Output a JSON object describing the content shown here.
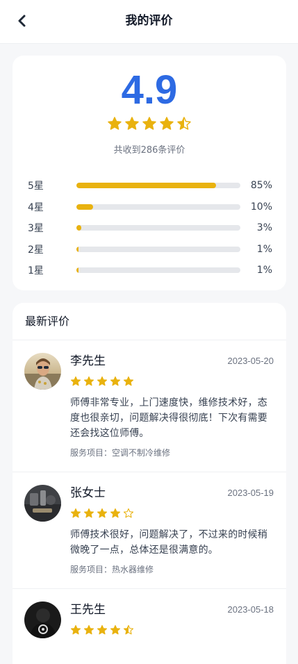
{
  "header": {
    "title": "我的评价",
    "back_icon": "chevron-left-icon"
  },
  "summary": {
    "score": "4.9",
    "rating": 4.5,
    "count_text": "共收到286条评价",
    "star_color": "#e9b20f",
    "accent_color": "#2d6ae3",
    "distribution": [
      {
        "label": "5星",
        "percent_text": "85%",
        "fraction": 0.85
      },
      {
        "label": "4星",
        "percent_text": "10%",
        "fraction": 0.1
      },
      {
        "label": "3星",
        "percent_text": "3%",
        "fraction": 0.03
      },
      {
        "label": "2星",
        "percent_text": "1%",
        "fraction": 0.01
      },
      {
        "label": "1星",
        "percent_text": "1%",
        "fraction": 0.01
      }
    ]
  },
  "reviews": {
    "title": "最新评价",
    "items": [
      {
        "name": "李先生",
        "date": "2023-05-20",
        "rating": 5,
        "text": "师傅非常专业，上门速度快，维修技术好，态度也很亲切，问题解决得很彻底！下次有需要还会找这位师傅。",
        "service": "服务项目：空调不制冷维修",
        "avatar_icon": "avatar-photo-woman-sunglasses"
      },
      {
        "name": "张女士",
        "date": "2023-05-19",
        "rating": 4,
        "text": "师傅技术很好，问题解决了，不过来的时候稍微晚了一点，总体还是很满意的。",
        "service": "服务项目：热水器维修",
        "avatar_icon": "avatar-photo-desk-items"
      },
      {
        "name": "王先生",
        "date": "2023-05-18",
        "rating": 4.5,
        "text": "",
        "service": "",
        "avatar_icon": "avatar-photo-dark-figure"
      }
    ]
  }
}
